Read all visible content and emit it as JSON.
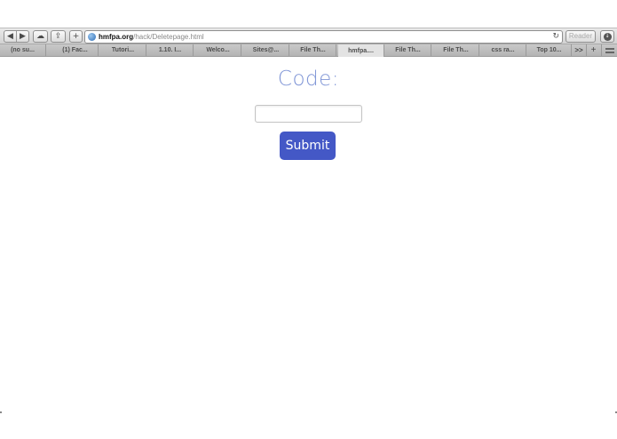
{
  "browser": {
    "url_host": "hmfpa.org",
    "url_path": "/hack/Deletepage.html",
    "reader_label": "Reader",
    "tabs": [
      {
        "label": "(no su..."
      },
      {
        "label": "(1) Fac..."
      },
      {
        "label": "Tutori..."
      },
      {
        "label": "1.10. I..."
      },
      {
        "label": "Welco..."
      },
      {
        "label": "Sites@..."
      },
      {
        "label": "File Th..."
      },
      {
        "label": "hmfpa...."
      },
      {
        "label": "File Th..."
      },
      {
        "label": "File Th..."
      },
      {
        "label": "css ra..."
      },
      {
        "label": "Top 10..."
      }
    ],
    "more_tabs_label": ">>",
    "add_tab_label": "+"
  },
  "page": {
    "code_label": "Code:",
    "code_input_value": "",
    "submit_label": "Submit"
  },
  "colors": {
    "label": "#7f95d6",
    "button": "#4458c6"
  }
}
